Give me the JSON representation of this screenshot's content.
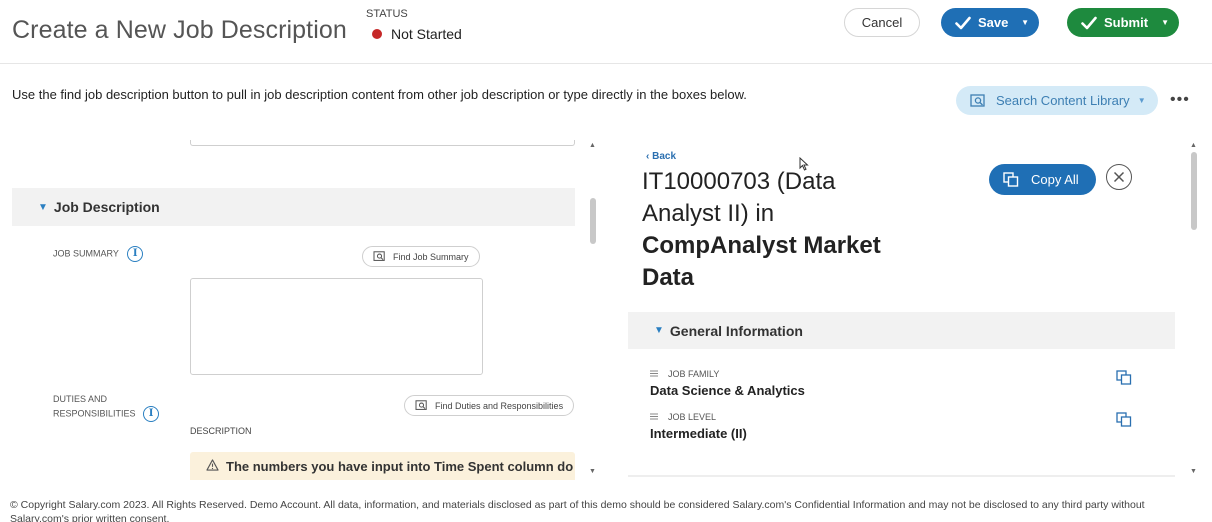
{
  "header": {
    "title": "Create a New Job Description",
    "status_label": "STATUS",
    "status_value": "Not Started",
    "cancel_label": "Cancel",
    "save_label": "Save",
    "submit_label": "Submit"
  },
  "toolbar": {
    "instructions": "Use the find job description button to pull in job description content from other job description or type directly in the boxes below.",
    "search_library_label": "Search Content Library",
    "more_label": "•••"
  },
  "left": {
    "section_title": "Job Description",
    "job_summary_label": "JOB SUMMARY",
    "find_job_summary_label": "Find Job Summary",
    "duties_label_line1": "DUTIES AND",
    "duties_label_line2": "RESPONSIBILITIES",
    "find_duties_label": "Find Duties and Responsibilities",
    "description_label": "DESCRIPTION",
    "warning_text": "The numbers you have input into Time Spent column do",
    "info_glyph": "i"
  },
  "right": {
    "back_label": "Back",
    "title_line1": "IT10000703 (Data",
    "title_line2": "Analyst II) in",
    "title_bold_line3": "CompAnalyst Market",
    "title_bold_line4": "Data",
    "copy_all_label": "Copy All",
    "general_info_title": "General Information",
    "fields": [
      {
        "label": "JOB FAMILY",
        "value": "Data Science & Analytics"
      },
      {
        "label": "JOB LEVEL",
        "value": "Intermediate (II)"
      }
    ]
  },
  "footer": {
    "copyright": "© Copyright Salary.com 2023. All Rights Reserved. Demo Account. All data, information, and materials disclosed as part of this demo should be considered Salary.com's Confidential Information and may not be disclosed to any third party without Salary.com's prior written consent."
  },
  "colors": {
    "primary_blue": "#1f6fb5",
    "submit_green": "#1e8a3e",
    "status_red": "#c62828",
    "search_bg": "#d4eaf7",
    "warning_bg": "#fbf1dc"
  }
}
